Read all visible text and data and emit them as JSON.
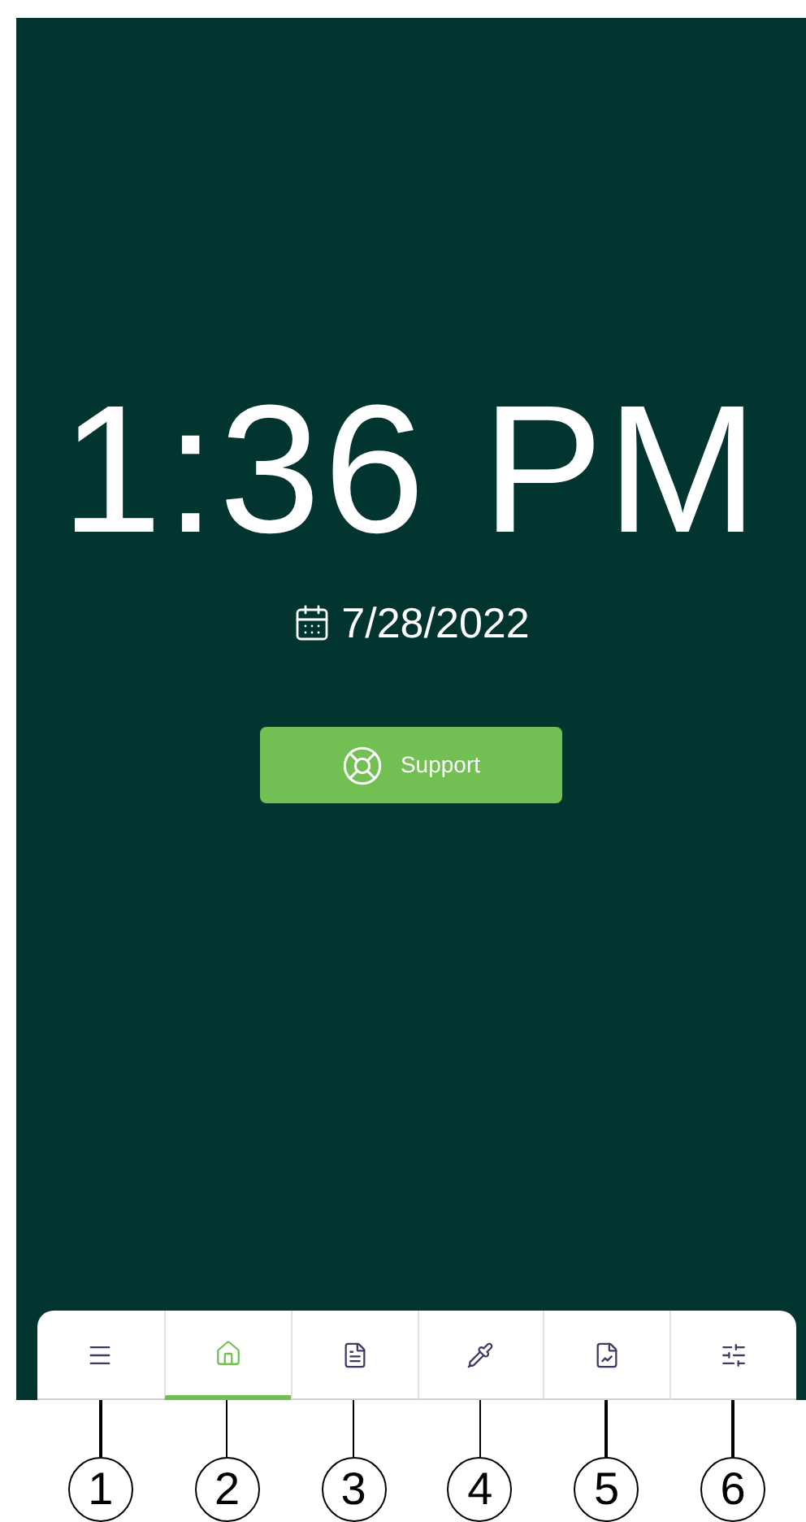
{
  "clock": {
    "time": "1:36 PM",
    "date": "7/28/2022"
  },
  "support_button": {
    "label": "Support"
  },
  "nav": {
    "tabs": [
      {
        "kind": "menu",
        "selected": false
      },
      {
        "kind": "home",
        "selected": true
      },
      {
        "kind": "document",
        "selected": false
      },
      {
        "kind": "pipette",
        "selected": false
      },
      {
        "kind": "report",
        "selected": false
      },
      {
        "kind": "sliders",
        "selected": false
      }
    ]
  },
  "callouts": [
    "1",
    "2",
    "3",
    "4",
    "5",
    "6"
  ]
}
